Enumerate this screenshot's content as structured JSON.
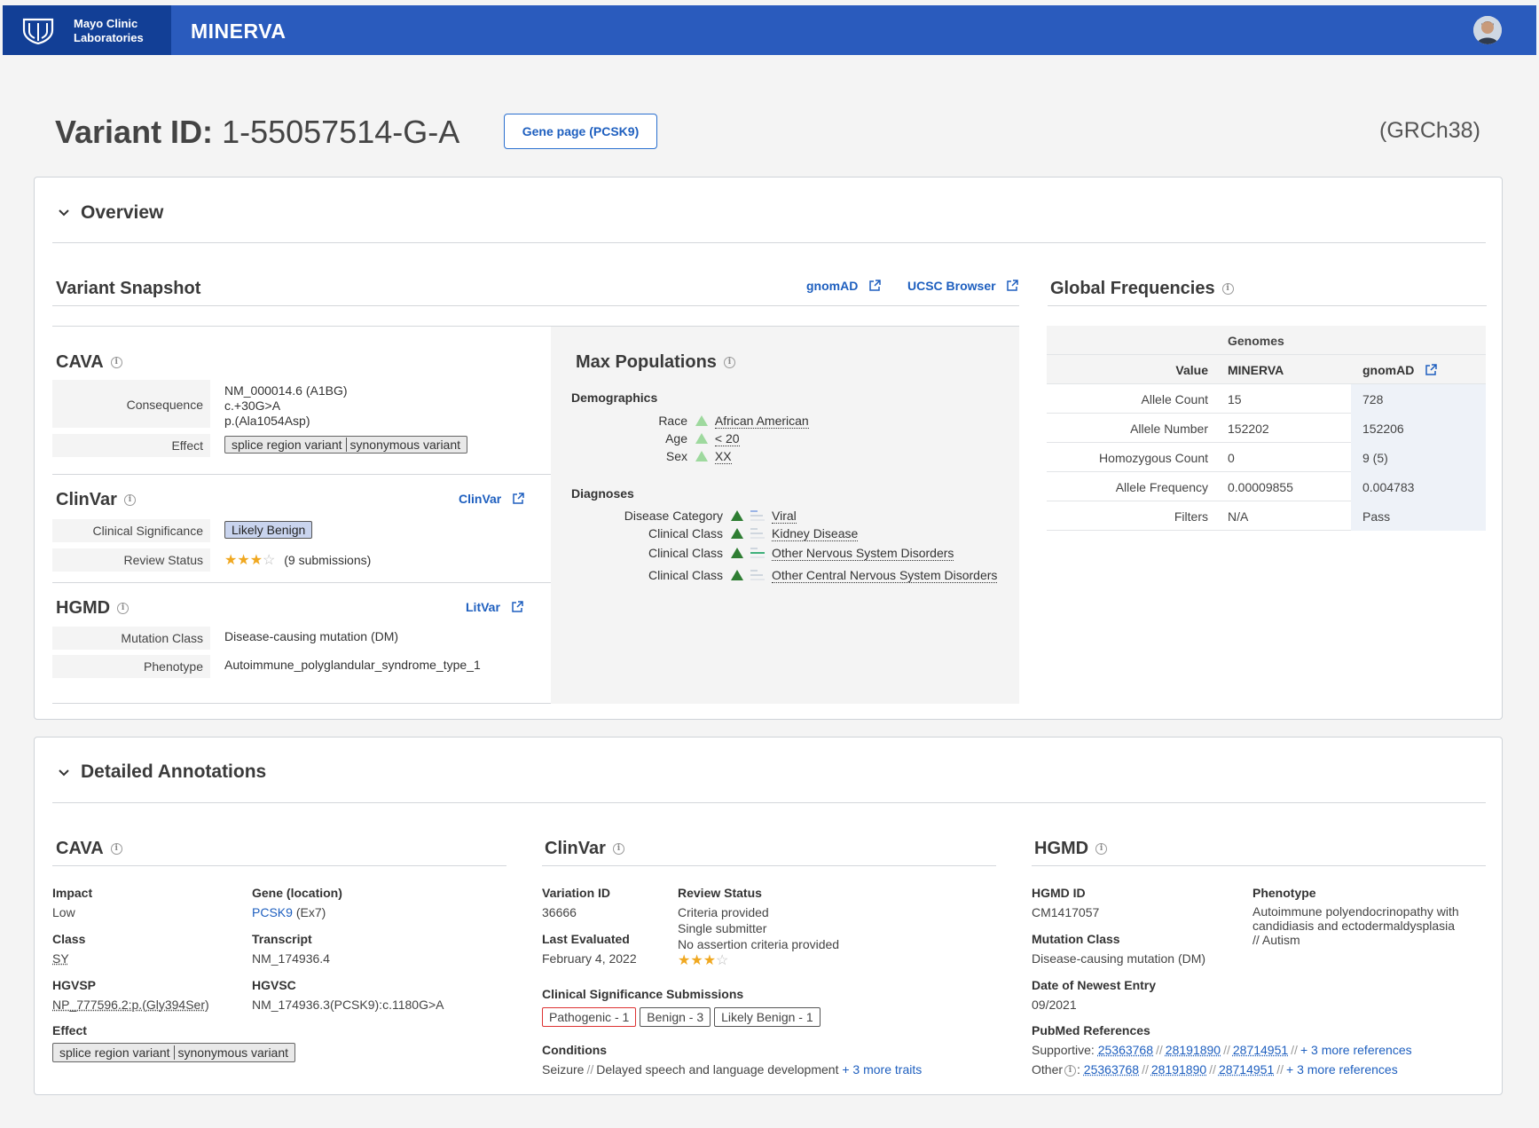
{
  "header": {
    "org_line1": "Mayo Clinic",
    "org_line2": "Laboratories",
    "app_name": "MINERVA"
  },
  "page": {
    "title_prefix": "Variant ID:",
    "variant_id": "1-55057514-G-A",
    "gene_button": "Gene page (PCSK9)",
    "assembly": "(GRCh38)"
  },
  "overview": {
    "title": "Overview",
    "snapshot_title": "Variant Snapshot",
    "links": {
      "gnomad": "gnomAD",
      "ucsc": "UCSC Browser"
    },
    "cava": {
      "title": "CAVA",
      "consequence_label": "Consequence",
      "consequence_lines": [
        "NM_000014.6 (A1BG)",
        "c.+30G>A",
        "p.(Ala1054Asp)"
      ],
      "effect_label": "Effect",
      "effect_a": "splice region variant",
      "effect_b": "synonymous variant"
    },
    "clinvar": {
      "title": "ClinVar",
      "link": "ClinVar",
      "sig_label": "Clinical Significance",
      "sig_value": "Likely Benign",
      "review_label": "Review Status",
      "review_stars": 3,
      "review_text": "(9 submissions)"
    },
    "hgmd": {
      "title": "HGMD",
      "link": "LitVar",
      "mut_label": "Mutation Class",
      "mut_value": "Disease-causing mutation (DM)",
      "pheno_label": "Phenotype",
      "pheno_value": "Autoimmune_polyglandular_syndrome_type_1"
    },
    "maxpop": {
      "title": "Max Populations",
      "demographics": "Demographics",
      "race_label": "Race",
      "race_value": "African American",
      "age_label": "Age",
      "age_value": "< 20",
      "sex_label": "Sex",
      "sex_value": "XX",
      "diagnoses": "Diagnoses",
      "diag": [
        {
          "label": "Disease Category",
          "value": "Viral",
          "bar_color": "#9bb4e6"
        },
        {
          "label": "Clinical Class",
          "value": "Kidney Disease",
          "bar_color": "#cfd6de"
        },
        {
          "label": "Clinical Class",
          "value": "Other Nervous System Disorders",
          "bar_color": "#3fb07a"
        },
        {
          "label": "Clinical Class",
          "value": "Other Central Nervous System Disorders",
          "bar_color": "#f0b400"
        }
      ]
    },
    "global": {
      "title": "Global Frequencies",
      "group_header": "Genomes",
      "col_value": "Value",
      "col_minerva": "MINERVA",
      "col_gnomad": "gnomAD",
      "rows": [
        {
          "label": "Allele Count",
          "minerva": "15",
          "gnomad": "728"
        },
        {
          "label": "Allele Number",
          "minerva": "152202",
          "gnomad": "152206"
        },
        {
          "label": "Homozygous Count",
          "minerva": "0",
          "gnomad": "9 (5)"
        },
        {
          "label": "Allele Frequency",
          "minerva": "0.00009855",
          "gnomad": "0.004783"
        },
        {
          "label": "Filters",
          "minerva": "N/A",
          "gnomad": "Pass"
        }
      ]
    }
  },
  "detailed": {
    "title": "Detailed Annotations",
    "cava": {
      "title": "CAVA",
      "impact_h": "Impact",
      "impact_v": "Low",
      "gene_h": "Gene (location)",
      "gene_v": "PCSK9",
      "gene_loc": "(Ex7)",
      "class_h": "Class",
      "class_v": "SY",
      "transcript_h": "Transcript",
      "transcript_v": "NM_174936.4",
      "hgvsp_h": "HGVSP",
      "hgvsp_v": "NP_777596.2:p.(Gly394Ser)",
      "hgvsc_h": "HGVSC",
      "hgvsc_v": "NM_174936.3(PCSK9):c.1180G>A",
      "effect_h": "Effect",
      "effect_a": "splice region variant",
      "effect_b": "synonymous variant"
    },
    "clinvar": {
      "title": "ClinVar",
      "varid_h": "Variation ID",
      "varid_v": "36666",
      "review_h": "Review Status",
      "review_lines": [
        "Criteria provided",
        "Single submitter",
        "No assertion criteria provided"
      ],
      "review_stars": 3,
      "last_h": "Last Evaluated",
      "last_v": "February 4, 2022",
      "subs_h": "Clinical Significance Submissions",
      "subs": [
        "Pathogenic - 1",
        "Benign - 3",
        "Likely Benign - 1"
      ],
      "cond_h": "Conditions",
      "cond_a": "Seizure",
      "cond_b": "Delayed speech and language development",
      "cond_more": "+ 3 more traits"
    },
    "hgmd": {
      "title": "HGMD",
      "id_h": "HGMD ID",
      "id_v": "CM1417057",
      "pheno_h": "Phenotype",
      "pheno_lines": [
        "Autoimmune polyendocrinopathy with",
        "candidiasis and ectodermaldysplasia",
        "// Autism"
      ],
      "mut_h": "Mutation Class",
      "mut_v": "Disease-causing mutation (DM)",
      "date_h": "Date of Newest Entry",
      "date_v": "09/2021",
      "pub_h": "PubMed References",
      "supportive_label": "Supportive:",
      "other_label": "Other",
      "refs": [
        "25363768",
        "28191890",
        "28714951"
      ],
      "more_refs": "+ 3 more references"
    }
  }
}
